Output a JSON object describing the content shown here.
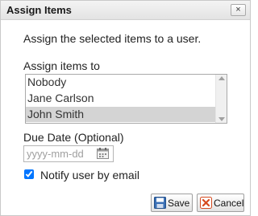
{
  "dialog": {
    "title": "Assign Items",
    "close_label": "×"
  },
  "intro_text": "Assign the selected items to a user.",
  "assign_to": {
    "label": "Assign items to",
    "options": [
      "Nobody",
      "Jane Carlson",
      "John Smith"
    ],
    "selected": "John Smith"
  },
  "due_date": {
    "label": "Due Date (Optional)",
    "placeholder": "yyyy-mm-dd",
    "value": ""
  },
  "notify": {
    "label": "Notify user by email",
    "checked": true
  },
  "buttons": {
    "save_label": "Save",
    "cancel_label": "Cancel"
  },
  "colors": {
    "selected_row": "#d4d4d4",
    "save_icon": "#3a6fb5",
    "cancel_icon": "#d64a1f"
  },
  "icons": [
    "close-icon",
    "calendar-icon",
    "save-icon",
    "cancel-icon",
    "scroll-up-icon",
    "scroll-down-icon"
  ]
}
